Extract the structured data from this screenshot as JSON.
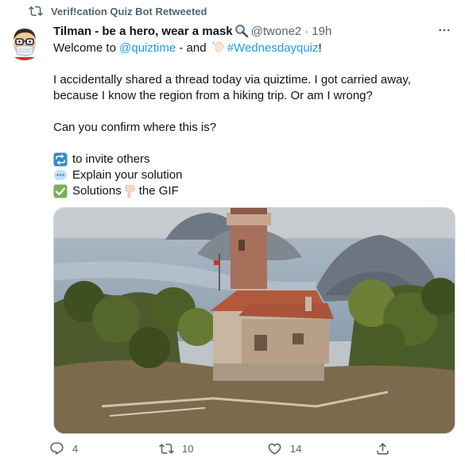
{
  "retweet_banner": {
    "text": "Verif!cation Quiz Bot Retweeted",
    "icon": "retweet-icon"
  },
  "author": {
    "name": "Tilman - be a hero, wear a mask",
    "name_icon": "magnifying-glass-icon",
    "handle": "@twone2",
    "separator": "·",
    "time": "19h",
    "avatar_icon": "masked-face-avatar"
  },
  "tweet": {
    "line1_prefix": "Welcome to ",
    "line1_mention": "@quiztime",
    "line1_mid": " - and ",
    "line1_hashtag": "#Wednesdayquiz",
    "line1_suffix": "!",
    "paragraph2": "I accidentally shared a thread today via quiztime. I got carried away, because I know the region from a hiking trip. Or am I wrong?",
    "paragraph3": "Can you confirm where this is?",
    "bullets": [
      {
        "icon": "repeat-emoji",
        "text": "to invite others"
      },
      {
        "icon": "speech-bubble-emoji",
        "text": "Explain your solution"
      },
      {
        "icon": "check-mark-emoji",
        "text_before": "Solutions",
        "inline_icon": "pointing-down-emoji",
        "text_after": "the GIF"
      }
    ]
  },
  "photo": {
    "subject": "lighthouse-on-coastal-hill-photo"
  },
  "actions": {
    "reply_count": "4",
    "retweet_count": "10",
    "like_count": "14"
  },
  "colors": {
    "link": "#1d9bf0",
    "secondary_text": "#536471",
    "primary_text": "#0f1419"
  }
}
